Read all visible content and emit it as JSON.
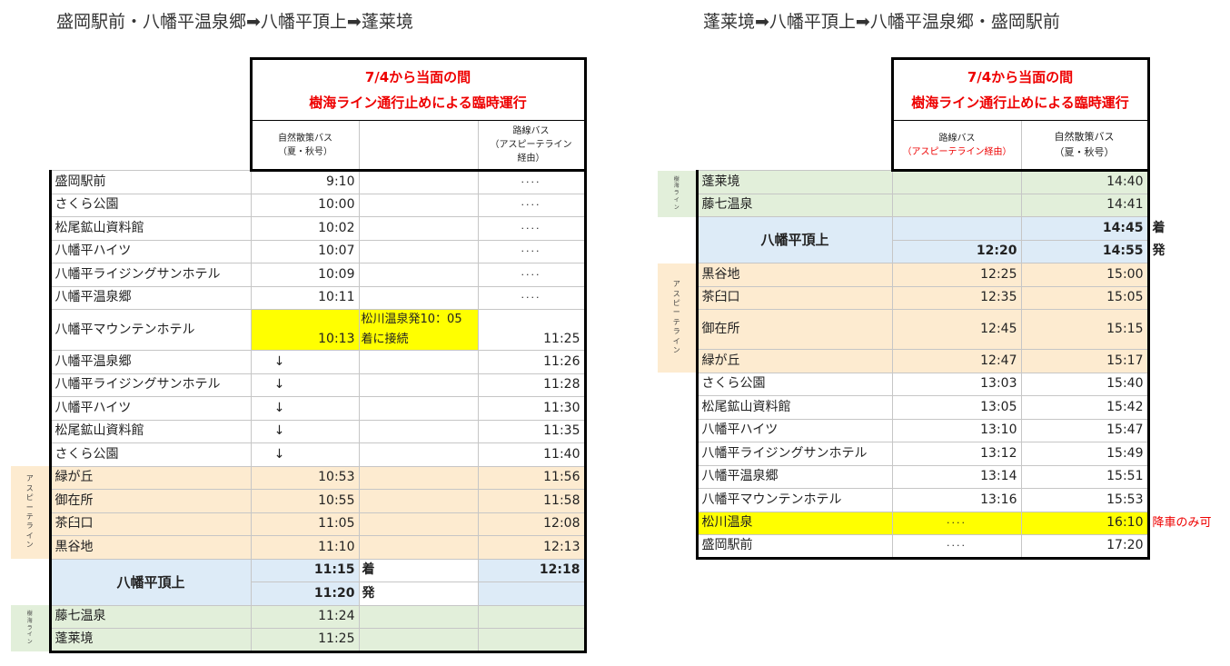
{
  "left": {
    "title": "盛岡駅前・八幡平温泉郷➡八幡平頂上➡蓬莱境",
    "notice_line1": "7/4から当面の間",
    "notice_line2": "樹海ライン通行止めによる臨時運行",
    "col1_header_l1": "自然散策バス",
    "col1_header_l2": "（夏・秋号）",
    "col3_header_l1": "路線バス",
    "col3_header_l2": "（アスピーテライン",
    "col3_header_l3": "経由）",
    "connection_note_l1": "松川温泉発10：05",
    "connection_note_l2": "着に接続",
    "side_aspite": "アスピーテライン",
    "side_jukai": "樹海ライン",
    "summit": "八幡平頂上",
    "arrive_label": "着",
    "depart_label": "発",
    "summit_arr": "11:15",
    "summit_dep": "11:20",
    "summit_bus": "12:18",
    "rows": [
      {
        "stop": "盛岡駅前",
        "a": "9:10",
        "b": "····"
      },
      {
        "stop": "さくら公園",
        "a": "10:00",
        "b": "····"
      },
      {
        "stop": "松尾鉱山資料館",
        "a": "10:02",
        "b": "····"
      },
      {
        "stop": "八幡平ハイツ",
        "a": "10:07",
        "b": "····"
      },
      {
        "stop": "八幡平ライジングサンホテル",
        "a": "10:09",
        "b": "····"
      },
      {
        "stop": "八幡平温泉郷",
        "a": "10:11",
        "b": "····"
      },
      {
        "stop": "八幡平マウンテンホテル",
        "a": "10:13",
        "b": "11:25"
      },
      {
        "stop": "八幡平温泉郷",
        "a": "↓",
        "b": "11:26"
      },
      {
        "stop": "八幡平ライジングサンホテル",
        "a": "↓",
        "b": "11:28"
      },
      {
        "stop": "八幡平ハイツ",
        "a": "↓",
        "b": "11:30"
      },
      {
        "stop": "松尾鉱山資料館",
        "a": "↓",
        "b": "11:35"
      },
      {
        "stop": "さくら公園",
        "a": "↓",
        "b": "11:40"
      },
      {
        "stop": "緑が丘",
        "a": "10:53",
        "b": "11:56"
      },
      {
        "stop": "御在所",
        "a": "10:55",
        "b": "11:58"
      },
      {
        "stop": "茶臼口",
        "a": "11:05",
        "b": "12:08"
      },
      {
        "stop": "黒谷地",
        "a": "11:10",
        "b": "12:13"
      },
      {
        "stop": "藤七温泉",
        "a": "11:24",
        "b": ""
      },
      {
        "stop": "蓬莱境",
        "a": "11:25",
        "b": ""
      }
    ]
  },
  "right": {
    "title": "蓬莱境➡八幡平頂上➡八幡平温泉郷・盛岡駅前",
    "notice_line1": "7/4から当面の間",
    "notice_line2": "樹海ライン通行止めによる臨時運行",
    "col1_header_l1": "路線バス",
    "col1_header_l2": "（アスピーテライン経由）",
    "col2_header_l1": "自然散策バス",
    "col2_header_l2": "（夏・秋号）",
    "side_jukai": "樹海ライン",
    "side_aspite": "アスピーテライン",
    "summit": "八幡平頂上",
    "arrive_label": "着",
    "depart_label": "発",
    "summit_arr_b": "14:45",
    "summit_dep_a": "12:20",
    "summit_dep_b": "14:55",
    "drop_note": "降車のみ可",
    "rows": [
      {
        "stop": "蓬莱境",
        "a": "",
        "b": "14:40"
      },
      {
        "stop": "藤七温泉",
        "a": "",
        "b": "14:41"
      },
      {
        "stop": "黒谷地",
        "a": "12:25",
        "b": "15:00"
      },
      {
        "stop": "茶臼口",
        "a": "12:35",
        "b": "15:05"
      },
      {
        "stop": "御在所",
        "a": "12:45",
        "b": "15:15"
      },
      {
        "stop": "緑が丘",
        "a": "12:47",
        "b": "15:17"
      },
      {
        "stop": "さくら公園",
        "a": "13:03",
        "b": "15:40"
      },
      {
        "stop": "松尾鉱山資料館",
        "a": "13:05",
        "b": "15:42"
      },
      {
        "stop": "八幡平ハイツ",
        "a": "13:10",
        "b": "15:47"
      },
      {
        "stop": "八幡平ライジングサンホテル",
        "a": "13:12",
        "b": "15:49"
      },
      {
        "stop": "八幡平温泉郷",
        "a": "13:14",
        "b": "15:51"
      },
      {
        "stop": "八幡平マウンテンホテル",
        "a": "13:16",
        "b": "15:53"
      },
      {
        "stop": "松川温泉",
        "a": "····",
        "b": "16:10"
      },
      {
        "stop": "盛岡駅前",
        "a": "····",
        "b": "17:20"
      }
    ]
  }
}
